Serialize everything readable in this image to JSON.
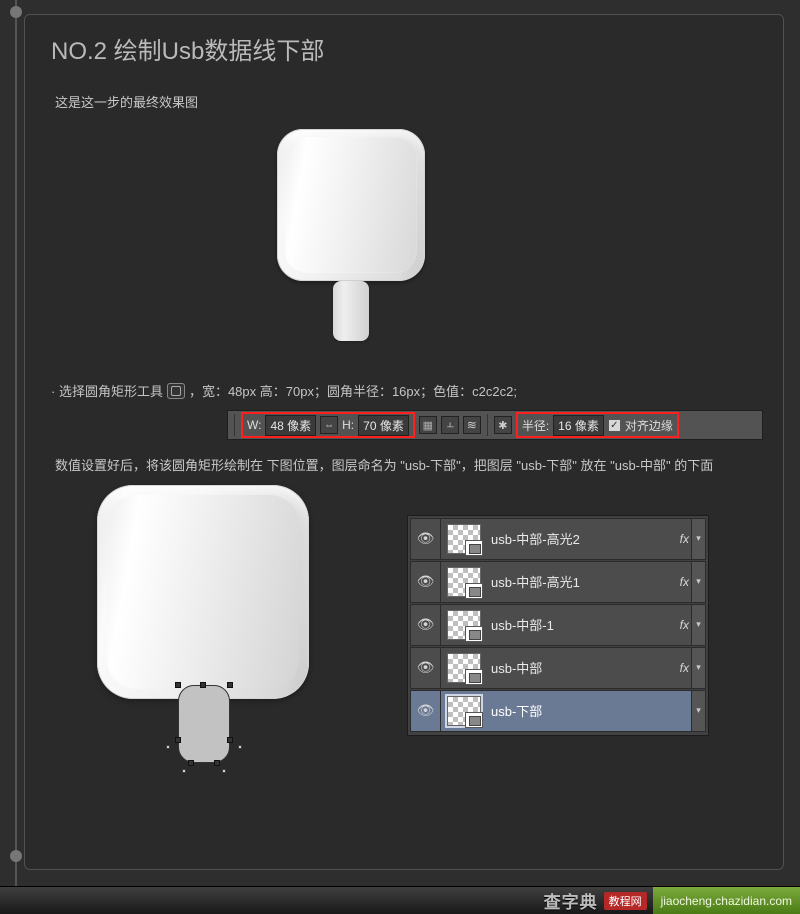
{
  "heading": "NO.2 绘制Usb数据线下部",
  "caption1": "这是这一步的最终效果图",
  "tool_desc_prefix": "· 选择圆角矩形工具",
  "tool_desc_suffix": "，宽：48px 高：70px；圆角半径：16px；色值：c2c2c2;",
  "options_bar": {
    "w_label": "W:",
    "w_value": "48 像素",
    "h_label": "H:",
    "h_value": "70 像素",
    "radius_label": "半径:",
    "radius_value": "16 像素",
    "align_edges": "对齐边缘",
    "align_checked": "✓"
  },
  "paragraph": "数值设置好后，将该圆角矩形绘制在 下图位置，图层命名为 \"usb-下部\"，把图层 \"usb-下部\" 放在 \"usb-中部\" 的下面",
  "layers": [
    {
      "name": "usb-中部-高光2",
      "fx": true,
      "selected": false
    },
    {
      "name": "usb-中部-高光1",
      "fx": true,
      "selected": false
    },
    {
      "name": "usb-中部-1",
      "fx": true,
      "selected": false
    },
    {
      "name": "usb-中部",
      "fx": true,
      "selected": false
    },
    {
      "name": "usb-下部",
      "fx": false,
      "selected": true
    }
  ],
  "fx_text": "fx",
  "dropdown_glyph": "▾",
  "eye_glyph": "👁",
  "watermark": {
    "site": "查字典",
    "tag": "教程网",
    "url": "jiaocheng.chazidian.com"
  }
}
